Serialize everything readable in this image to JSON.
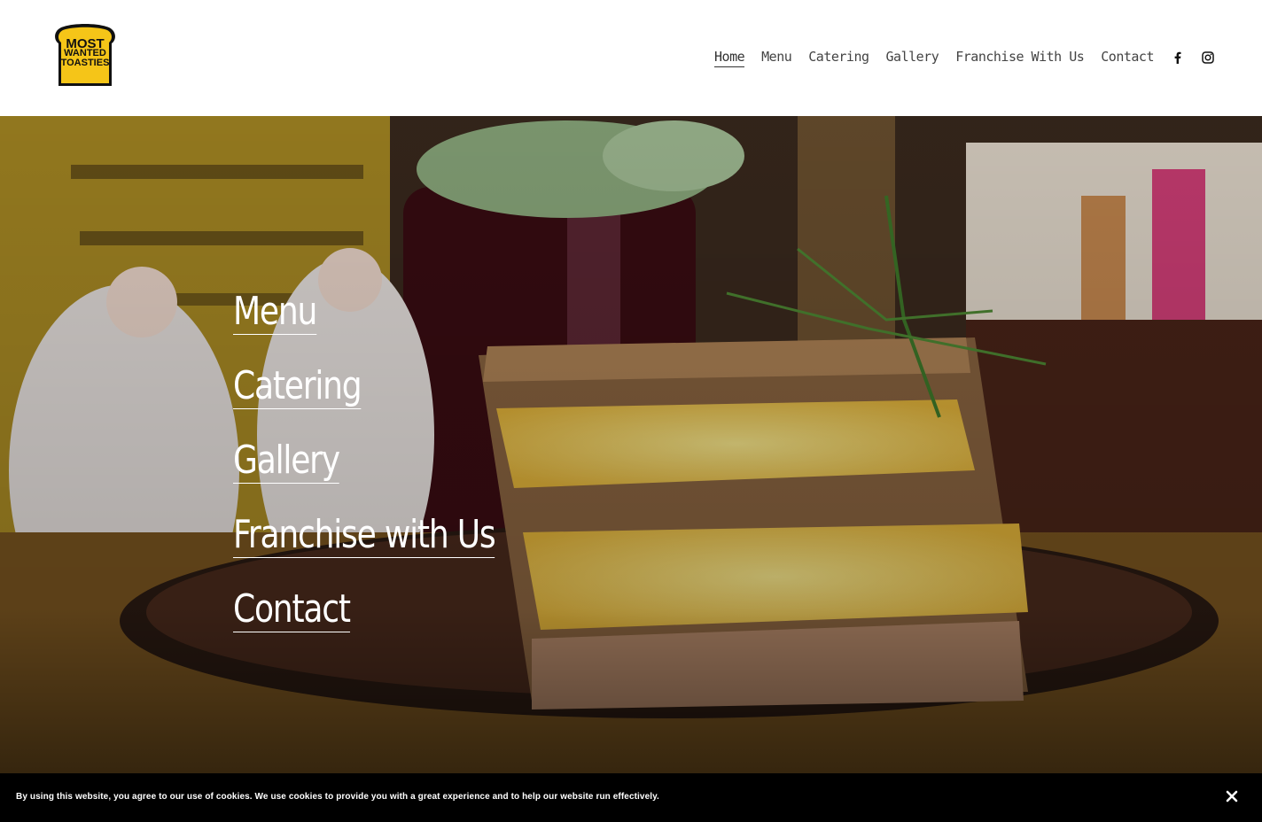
{
  "header": {
    "logo": {
      "line1": "MOST",
      "line2": "WANTED",
      "line3": "TOASTIES",
      "brand_yellow": "#f5c518"
    },
    "nav": [
      {
        "label": "Home",
        "active": true
      },
      {
        "label": "Menu",
        "active": false
      },
      {
        "label": "Catering",
        "active": false
      },
      {
        "label": "Gallery",
        "active": false
      },
      {
        "label": "Franchise With Us",
        "active": false
      },
      {
        "label": "Contact",
        "active": false
      }
    ],
    "social": [
      "facebook-icon",
      "instagram-icon"
    ]
  },
  "hero": {
    "links": [
      "Menu",
      "Catering",
      "Gallery",
      "Franchise with Us",
      "Contact"
    ],
    "image": "toasted-sandwich-photo"
  },
  "cookie_bar": {
    "text": "By using this website, you agree to our use of cookies. We use cookies to provide you with a great experience and to help our website run effectively.",
    "close_icon": "close-icon"
  }
}
